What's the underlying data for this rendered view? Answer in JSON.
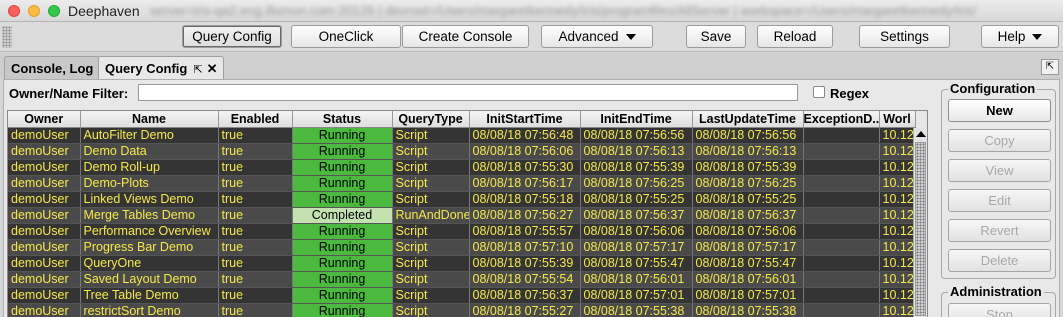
{
  "window": {
    "title": "Deephaven",
    "path": "server=iris-qa2.eng.illumon.com:20126 | devroot=/Users/margaretkennedy/iris/programfiles/AllServer | workspace=/Users/margaretkennedy/iris/"
  },
  "toolbar": {
    "buttons": [
      {
        "label": "Query Config"
      },
      {
        "label": "OneClick"
      },
      {
        "label": "Create Console"
      },
      {
        "label": "Advanced"
      },
      {
        "label": "Save"
      },
      {
        "label": "Reload"
      },
      {
        "label": "Settings"
      },
      {
        "label": "Help"
      }
    ]
  },
  "tabs": [
    {
      "label": "Console, Log"
    },
    {
      "label": "Query Config",
      "pin": "⇱",
      "close": "✕"
    }
  ],
  "maximize_icon": "⇱",
  "filter": {
    "label": "Owner/Name Filter:",
    "value": "",
    "regex_label": "Regex"
  },
  "table": {
    "columns": [
      "Owner",
      "Name",
      "Enabled",
      "Status",
      "QueryType",
      "InitStartTime",
      "InitEndTime",
      "LastUpdateTime",
      "ExceptionD...",
      "Worl"
    ],
    "rows": [
      [
        "demoUser",
        "AutoFilter Demo",
        "true",
        "Running",
        "Script",
        "08/08/18 07:56:48",
        "08/08/18 07:56:56",
        "08/08/18 07:56:56",
        "",
        "10.12"
      ],
      [
        "demoUser",
        "Demo Data",
        "true",
        "Running",
        "Script",
        "08/08/18 07:56:06",
        "08/08/18 07:56:13",
        "08/08/18 07:56:13",
        "",
        "10.12"
      ],
      [
        "demoUser",
        "Demo Roll-up",
        "true",
        "Running",
        "Script",
        "08/08/18 07:55:30",
        "08/08/18 07:55:39",
        "08/08/18 07:55:39",
        "",
        "10.12"
      ],
      [
        "demoUser",
        "Demo-Plots",
        "true",
        "Running",
        "Script",
        "08/08/18 07:56:17",
        "08/08/18 07:56:25",
        "08/08/18 07:56:25",
        "",
        "10.12"
      ],
      [
        "demoUser",
        "Linked Views Demo",
        "true",
        "Running",
        "Script",
        "08/08/18 07:55:18",
        "08/08/18 07:55:25",
        "08/08/18 07:55:25",
        "",
        "10.12"
      ],
      [
        "demoUser",
        "Merge Tables Demo",
        "true",
        "Completed",
        "RunAndDone",
        "08/08/18 07:56:27",
        "08/08/18 07:56:37",
        "08/08/18 07:56:37",
        "",
        "10.12"
      ],
      [
        "demoUser",
        "Performance Overview",
        "true",
        "Running",
        "Script",
        "08/08/18 07:55:57",
        "08/08/18 07:56:06",
        "08/08/18 07:56:06",
        "",
        "10.12"
      ],
      [
        "demoUser",
        "Progress Bar Demo",
        "true",
        "Running",
        "Script",
        "08/08/18 07:57:10",
        "08/08/18 07:57:17",
        "08/08/18 07:57:17",
        "",
        "10.12"
      ],
      [
        "demoUser",
        "QueryOne",
        "true",
        "Running",
        "Script",
        "08/08/18 07:55:39",
        "08/08/18 07:55:47",
        "08/08/18 07:55:47",
        "",
        "10.12"
      ],
      [
        "demoUser",
        "Saved Layout Demo",
        "true",
        "Running",
        "Script",
        "08/08/18 07:55:54",
        "08/08/18 07:56:01",
        "08/08/18 07:56:01",
        "",
        "10.12"
      ],
      [
        "demoUser",
        "Tree Table Demo",
        "true",
        "Running",
        "Script",
        "08/08/18 07:56:37",
        "08/08/18 07:57:01",
        "08/08/18 07:57:01",
        "",
        "10.12"
      ],
      [
        "demoUser",
        "restrictSort Demo",
        "true",
        "Running",
        "Script",
        "08/08/18 07:55:27",
        "08/08/18 07:55:38",
        "08/08/18 07:55:38",
        "",
        "10.12"
      ]
    ]
  },
  "side": {
    "configuration_title": "Configuration",
    "configuration_buttons": [
      {
        "label": "New",
        "enabled": true
      },
      {
        "label": "Copy",
        "enabled": false
      },
      {
        "label": "View",
        "enabled": false
      },
      {
        "label": "Edit",
        "enabled": false
      },
      {
        "label": "Revert",
        "enabled": false
      },
      {
        "label": "Delete",
        "enabled": false
      }
    ],
    "administration_title": "Administration",
    "administration_buttons": [
      {
        "label": "Stop",
        "enabled": false
      }
    ]
  },
  "colors": {
    "row_text": "#f7e84a",
    "running": "#4cb93f",
    "completed": "#c3e2b0",
    "row_dark": "#343434",
    "row_light": "#4a4a4a"
  }
}
